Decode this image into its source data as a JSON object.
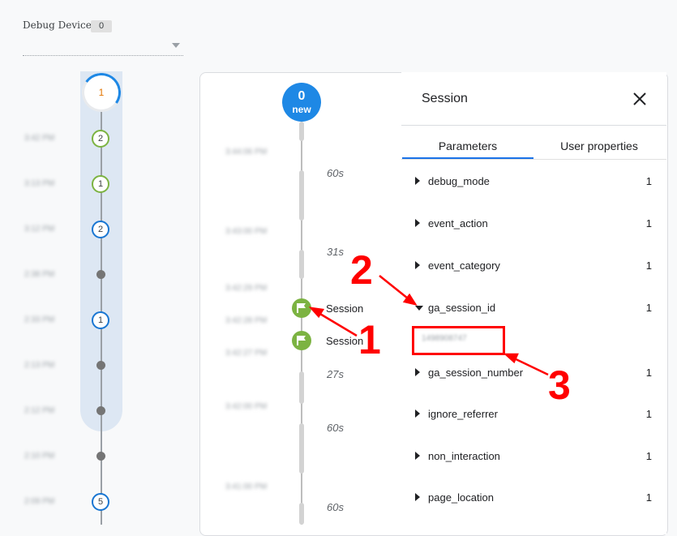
{
  "debug_device": {
    "label": "Debug Device",
    "count": "0",
    "selected": ""
  },
  "minutes": {
    "current": "1",
    "items": [
      {
        "time": "3:42 PM",
        "kind": "circle",
        "count": "2",
        "color": "green"
      },
      {
        "time": "3:13 PM",
        "kind": "circle",
        "count": "1",
        "color": "green"
      },
      {
        "time": "3:12 PM",
        "kind": "circle",
        "count": "2",
        "color": "teal"
      },
      {
        "time": "2:38 PM",
        "kind": "dot",
        "count": ""
      },
      {
        "time": "2:33 PM",
        "kind": "circle",
        "count": "1",
        "color": "blue"
      },
      {
        "time": "2:13 PM",
        "kind": "dot",
        "count": ""
      },
      {
        "time": "2:12 PM",
        "kind": "dot",
        "count": ""
      },
      {
        "time": "2:10 PM",
        "kind": "dot",
        "count": ""
      },
      {
        "time": "2:09 PM",
        "kind": "circle",
        "count": "5",
        "color": "teal"
      }
    ]
  },
  "seconds": {
    "new_count": "0",
    "new_label": "new",
    "times": [
      "3:44:06 PM",
      "3:43:00 PM",
      "3:42:29 PM",
      "3:42:28 PM",
      "3:42:27 PM",
      "3:42:00 PM",
      "3:41:00 PM"
    ],
    "gaps": [
      "60s",
      "31s",
      "27s",
      "60s",
      "60s"
    ],
    "events": [
      {
        "label": "Session",
        "icon": "flag-icon"
      },
      {
        "label": "Session",
        "icon": "flag-icon"
      }
    ]
  },
  "details": {
    "title": "Session",
    "close_icon": "close-icon",
    "tabs": [
      {
        "label": "Parameters",
        "active": true
      },
      {
        "label": "User properties",
        "active": false
      }
    ],
    "parameters": [
      {
        "name": "debug_mode",
        "count": "1",
        "expanded": false
      },
      {
        "name": "event_action",
        "count": "1",
        "expanded": false
      },
      {
        "name": "event_category",
        "count": "1",
        "expanded": false
      },
      {
        "name": "ga_session_id",
        "count": "1",
        "expanded": true,
        "value": "1498908747"
      },
      {
        "name": "ga_session_number",
        "count": "1",
        "expanded": false
      },
      {
        "name": "ignore_referrer",
        "count": "1",
        "expanded": false
      },
      {
        "name": "non_interaction",
        "count": "1",
        "expanded": false
      },
      {
        "name": "page_location",
        "count": "1",
        "expanded": false
      }
    ]
  },
  "annotations": {
    "labels": [
      "1",
      "2",
      "3"
    ],
    "color": "#ff0000"
  },
  "colors": {
    "accent": "#1a73e8",
    "new_badge": "#1e88e5",
    "event_green": "#7cb342",
    "minutes_band": "#dde7f3"
  }
}
